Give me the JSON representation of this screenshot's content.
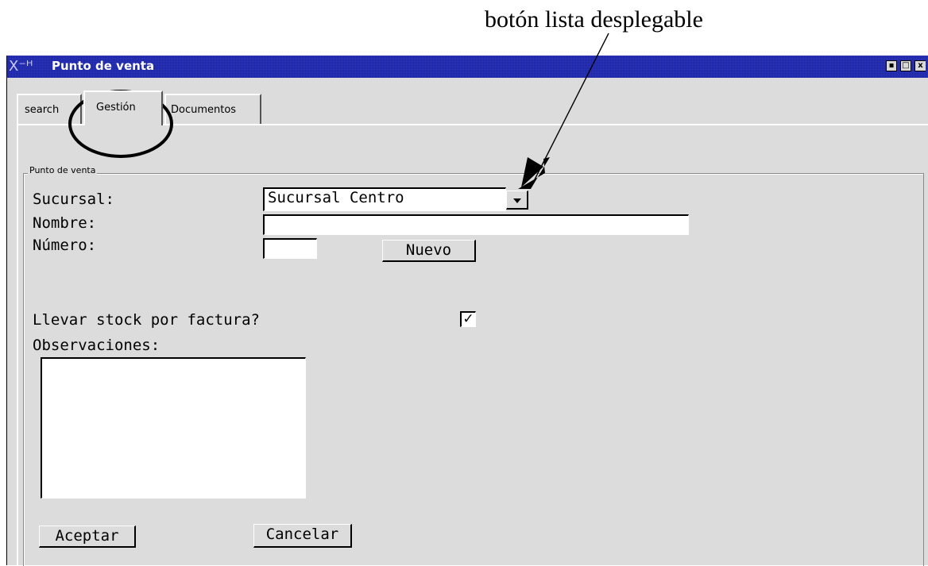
{
  "annotation": {
    "text": "botón lista desplegable"
  },
  "window": {
    "title": "Punto de venta",
    "title_icon": "X⁻ᴴ",
    "controls": {
      "minimize": "▪",
      "maximize": "□",
      "close": "x"
    }
  },
  "tabs": [
    {
      "label": "search",
      "selected": false
    },
    {
      "label": "Gestión",
      "selected": true
    },
    {
      "label": "Documentos",
      "selected": false
    }
  ],
  "group": {
    "legend": "Punto de venta",
    "sucursal_label": "Sucursal:",
    "sucursal_value": "Sucursal Centro",
    "nombre_label": "Nombre:",
    "nombre_value": "",
    "numero_label": "Número:",
    "numero_value": "",
    "nuevo_label": "Nuevo",
    "stock_label": "Llevar stock por factura?",
    "stock_checked": true,
    "stock_check_glyph": "✓",
    "observaciones_label": "Observaciones:",
    "observaciones_value": "",
    "aceptar_label": "Aceptar",
    "cancelar_label": "Cancelar"
  },
  "icons": {
    "dropdown": "chevron-down-icon",
    "check": "checkmark-icon"
  }
}
